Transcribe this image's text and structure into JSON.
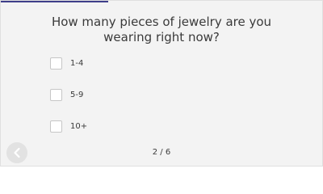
{
  "progress": {
    "fraction": 0.333,
    "color": "#3f3f8a"
  },
  "question": {
    "text": "How many pieces of jewelry are you wearing right now?"
  },
  "options": [
    {
      "label": "1-4",
      "checked": false
    },
    {
      "label": "5-9",
      "checked": false
    },
    {
      "label": "10+",
      "checked": false
    }
  ],
  "navigation": {
    "back_icon": "chevron-left-icon",
    "page_indicator": "2 / 6"
  }
}
